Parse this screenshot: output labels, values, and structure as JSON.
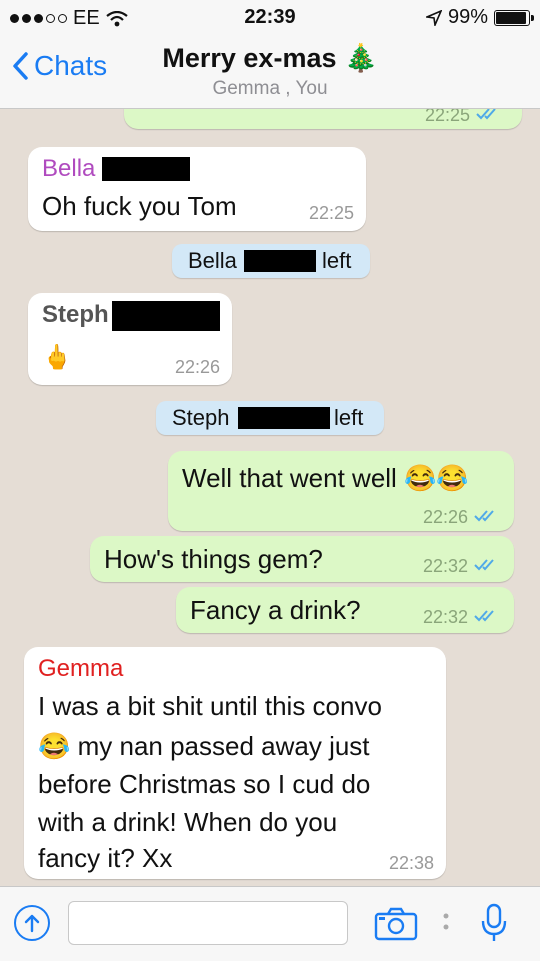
{
  "status": {
    "carrier": "EE",
    "time": "22:39",
    "battery": "99%"
  },
  "header": {
    "back_label": "Chats",
    "title": "Merry ex-mas 🎄",
    "subtitle": "Gemma , You"
  },
  "messages": {
    "top_time": "22:25",
    "bella_name": "Bella",
    "bella_text": "Oh fuck you Tom",
    "bella_time": "22:25",
    "bella_left_name": "Bella",
    "bella_left_word": "left",
    "steph_name": "Steph",
    "steph_emoji": "🖕",
    "steph_time": "22:26",
    "steph_left_name": "Steph",
    "steph_left_word": "left",
    "out1_text": "Well that went well 😂😂",
    "out1_time": "22:26",
    "out2_text": "How's things gem?",
    "out2_time": "22:32",
    "out3_text": "Fancy a drink?",
    "out3_time": "22:32",
    "gemma_name": "Gemma",
    "gemma_line1": "I was a bit shit until this convo",
    "gemma_line2": "😂 my nan passed away just",
    "gemma_line3": "before Christmas so I cud do",
    "gemma_line4": "with a drink! When do you",
    "gemma_line5": "fancy it? Xx",
    "gemma_time": "22:38"
  },
  "input": {
    "placeholder": ""
  },
  "colors": {
    "accent": "#1a7cf3",
    "outgoing": "#dcf8c6",
    "system": "#d3e8f7",
    "bella": "#b04bbf",
    "gemma": "#e02020"
  }
}
